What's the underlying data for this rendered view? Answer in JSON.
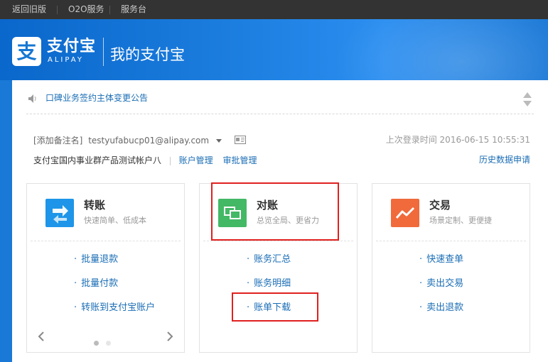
{
  "topbar": {
    "links": [
      "返回旧版",
      "O2O服务",
      "服务台"
    ]
  },
  "header": {
    "logo_text": "支付宝",
    "logo_sub": "ALIPAY",
    "title": "我的支付宝"
  },
  "notice": {
    "text": "口碑业务签约主体变更公告"
  },
  "account": {
    "remark": "[添加备注名]",
    "email": "testyufabucp01@alipay.com",
    "last_login_label": "上次登录时间",
    "last_login_time": "2016-06-15 10:55:31",
    "name": "支付宝国内事业群产品测试帐户八",
    "links": [
      "账户管理",
      "审批管理"
    ],
    "history_link": "历史数据申请"
  },
  "cards": [
    {
      "title": "转账",
      "subtitle": "快速简单、低成本",
      "icon": "transfer-icon",
      "color": "#1e95e8",
      "links": [
        "批量退款",
        "批量付款",
        "转账到支付宝账户"
      ]
    },
    {
      "title": "对账",
      "subtitle": "总览全局、更省力",
      "icon": "reconcile-icon",
      "color": "#43b865",
      "links": [
        "账务汇总",
        "账务明细",
        "账单下载"
      ]
    },
    {
      "title": "交易",
      "subtitle": "场景定制、更便捷",
      "icon": "trade-chart-icon",
      "color": "#f06a3c",
      "links": [
        "快速查单",
        "卖出交易",
        "卖出退款"
      ]
    }
  ],
  "carousel": {
    "pages": 2,
    "active": 1
  },
  "colors": {
    "link": "#1a6db5",
    "highlight": "#e0201f",
    "topbar": "#333333",
    "header": "#1a78d6"
  }
}
